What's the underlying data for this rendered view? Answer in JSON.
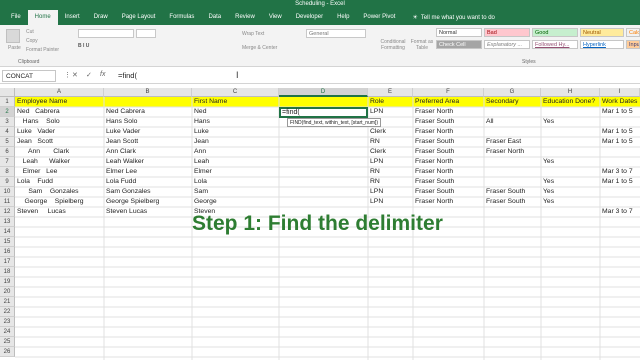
{
  "window": {
    "title": "Scheduling - Excel"
  },
  "tabs": [
    "File",
    "Home",
    "Insert",
    "Draw",
    "Page Layout",
    "Formulas",
    "Data",
    "Review",
    "View",
    "Developer",
    "Help",
    "Power Pivot"
  ],
  "active_tab": "Home",
  "tell_me": "Tell me what you want to do",
  "ribbon": {
    "paste": "Paste",
    "cut": "Cut",
    "copy": "Copy",
    "format_painter": "Format Painter",
    "clipboard_group": "Clipboard",
    "wrap_text": "Wrap Text",
    "merge_center": "Merge & Center",
    "number_format": "General",
    "conditional_formatting": "Conditional Formatting",
    "format_as_table": "Format as Table",
    "styles_group": "Styles",
    "styles": [
      "Normal",
      "Bad",
      "Good",
      "Neutral",
      "Calcu",
      "Check Cell",
      "Explanatory ...",
      "Followed Hy...",
      "Hyperlink",
      "Input"
    ]
  },
  "formula_bar": {
    "name_box": "CONCAT",
    "formula": "=find("
  },
  "columns": [
    "A",
    "B",
    "C",
    "D",
    "E",
    "F",
    "G",
    "H",
    "I"
  ],
  "selected_column": "D",
  "rows": [
    "1",
    "2",
    "3",
    "4",
    "5",
    "6",
    "7",
    "8",
    "9",
    "10",
    "11",
    "12",
    "13",
    "14",
    "15",
    "16",
    "17",
    "18",
    "19",
    "20",
    "21",
    "22",
    "23",
    "24",
    "25",
    "26"
  ],
  "selected_row": "2",
  "sheet": {
    "headers": [
      "Employee Name",
      "",
      "First Name",
      "",
      "Role",
      "Preferred Area",
      "Secondary",
      "Education Done?",
      "Work Dates"
    ],
    "data": [
      [
        "Ned   Cabrera",
        "Ned Cabrera",
        "Ned",
        "",
        "LPN",
        "Fraser North",
        "",
        "",
        "Mar 1 to 5"
      ],
      [
        "   Hans    Solo",
        "Hans Solo",
        "Hans",
        "",
        "",
        "Fraser South",
        "All",
        "Yes",
        ""
      ],
      [
        "Luke   Vader",
        "Luke Vader",
        "Luke",
        "",
        "Clerk",
        "Fraser North",
        "",
        "",
        "Mar 1 to 5"
      ],
      [
        "Jean   Scott",
        "Jean Scott",
        "Jean",
        "",
        "RN",
        "Fraser South",
        "Fraser East",
        "",
        "Mar 1 to 5"
      ],
      [
        "      Ann       Clark",
        "Ann Clark",
        "Ann",
        "",
        "Clerk",
        "Fraser South",
        "Fraser North",
        "",
        ""
      ],
      [
        "   Leah      Walker",
        "Leah Walker",
        "Leah",
        "",
        "LPN",
        "Fraser North",
        "",
        "Yes",
        ""
      ],
      [
        "   Elmer   Lee",
        "Elmer Lee",
        "Elmer",
        "",
        "RN",
        "Fraser North",
        "",
        "",
        "Mar 3 to 7"
      ],
      [
        "Lola    Fudd",
        "Lola Fudd",
        "Lola",
        "",
        "RN",
        "Fraser South",
        "",
        "Yes",
        "Mar 1 to 5"
      ],
      [
        "      Sam    Gonzales",
        "Sam Gonzales",
        "Sam",
        "",
        "LPN",
        "Fraser South",
        "Fraser South",
        "Yes",
        ""
      ],
      [
        "    George    Spielberg",
        "George Spielberg",
        "George",
        "",
        "LPN",
        "Fraser North",
        "Fraser South",
        "Yes",
        ""
      ],
      [
        "Steven     Lucas",
        "Steven Lucas",
        "Steven",
        "",
        "",
        "",
        "",
        "",
        "Mar 3 to 7"
      ]
    ]
  },
  "active_cell_text": "=find(",
  "tooltip": "FIND(find_text, within_text, [start_num])",
  "overlay_caption": "Step 1: Find the delimiter",
  "colors": {
    "excel_green": "#217346",
    "header_fill": "#ffff00",
    "overlay_text": "#2e7d32"
  }
}
